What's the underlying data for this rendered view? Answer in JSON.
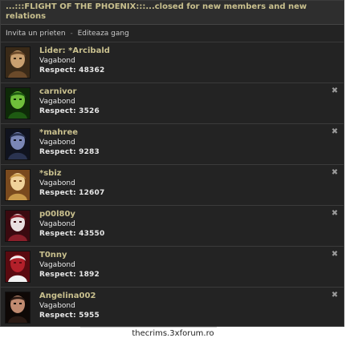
{
  "gang": {
    "title": "...:::FLIGHT OF THE PHOENIX:::...closed for new members and new relations"
  },
  "links": {
    "invite": "Invita un prieten",
    "separator": "-",
    "edit": "Editeaza gang"
  },
  "members": [
    {
      "name": "Lider: *Arcibald",
      "rank": "Vagabond",
      "respect": "Respect: 48362",
      "avatar": "avatar-portrait-icon",
      "colors": [
        "#6b4a2a",
        "#c9a070",
        "#3a2a18"
      ]
    },
    {
      "name": "carnivor",
      "rank": "Vagabond",
      "respect": "Respect: 3526",
      "avatar": "avatar-green-monster-icon",
      "colors": [
        "#1e5a12",
        "#6fbf3a",
        "#0e2a08"
      ]
    },
    {
      "name": "*mahree",
      "rank": "Vagabond",
      "respect": "Respect: 9283",
      "avatar": "avatar-dark-face-icon",
      "colors": [
        "#2a3350",
        "#7a86b5",
        "#10131e"
      ]
    },
    {
      "name": "*sbiz",
      "rank": "Vagabond",
      "respect": "Respect: 12607",
      "avatar": "avatar-blond-face-icon",
      "colors": [
        "#c99a4a",
        "#f0d29a",
        "#7a4a1e"
      ]
    },
    {
      "name": "p00l80y",
      "rank": "Vagabond",
      "respect": "Respect: 43550",
      "avatar": "avatar-hat-figure-icon",
      "colors": [
        "#8a1f2a",
        "#e8e0e0",
        "#3a0a10"
      ]
    },
    {
      "name": "T0nny",
      "rank": "Vagabond",
      "respect": "Respect: 1892",
      "avatar": "avatar-red-figure-icon",
      "colors": [
        "#f2f2f2",
        "#b3202a",
        "#5a0a10"
      ]
    },
    {
      "name": "Angelina002",
      "rank": "Vagabond",
      "respect": "Respect: 5955",
      "avatar": "avatar-dark-hair-icon",
      "colors": [
        "#2a1a14",
        "#c08a70",
        "#0e0806"
      ]
    }
  ],
  "kick_icon": "close-icon",
  "footer": {
    "link": "thecrims.3xforum.ro"
  }
}
